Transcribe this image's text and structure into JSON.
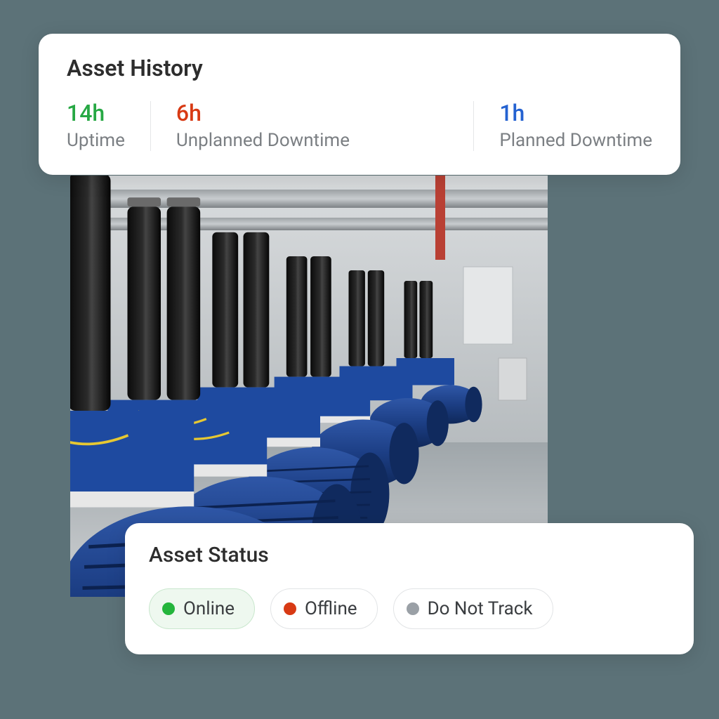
{
  "history": {
    "title": "Asset History",
    "metrics": [
      {
        "value": "14h",
        "label": "Uptime",
        "color": "#27a844"
      },
      {
        "value": "6h",
        "label": "Unplanned Downtime",
        "color": "#d83a14"
      },
      {
        "value": "1h",
        "label": "Planned Downtime",
        "color": "#2462d1"
      }
    ]
  },
  "status": {
    "title": "Asset Status",
    "options": [
      {
        "label": "Online",
        "dot_color": "#24b53c",
        "selected": true
      },
      {
        "label": "Offline",
        "dot_color": "#d83a14",
        "selected": false
      },
      {
        "label": "Do Not Track",
        "dot_color": "#9aa0a6",
        "selected": false
      }
    ]
  },
  "asset_image": {
    "description": "Row of industrial blue electric motor pumps with black vertical hydraulic cylinders and overhead piping inside a plant room."
  }
}
